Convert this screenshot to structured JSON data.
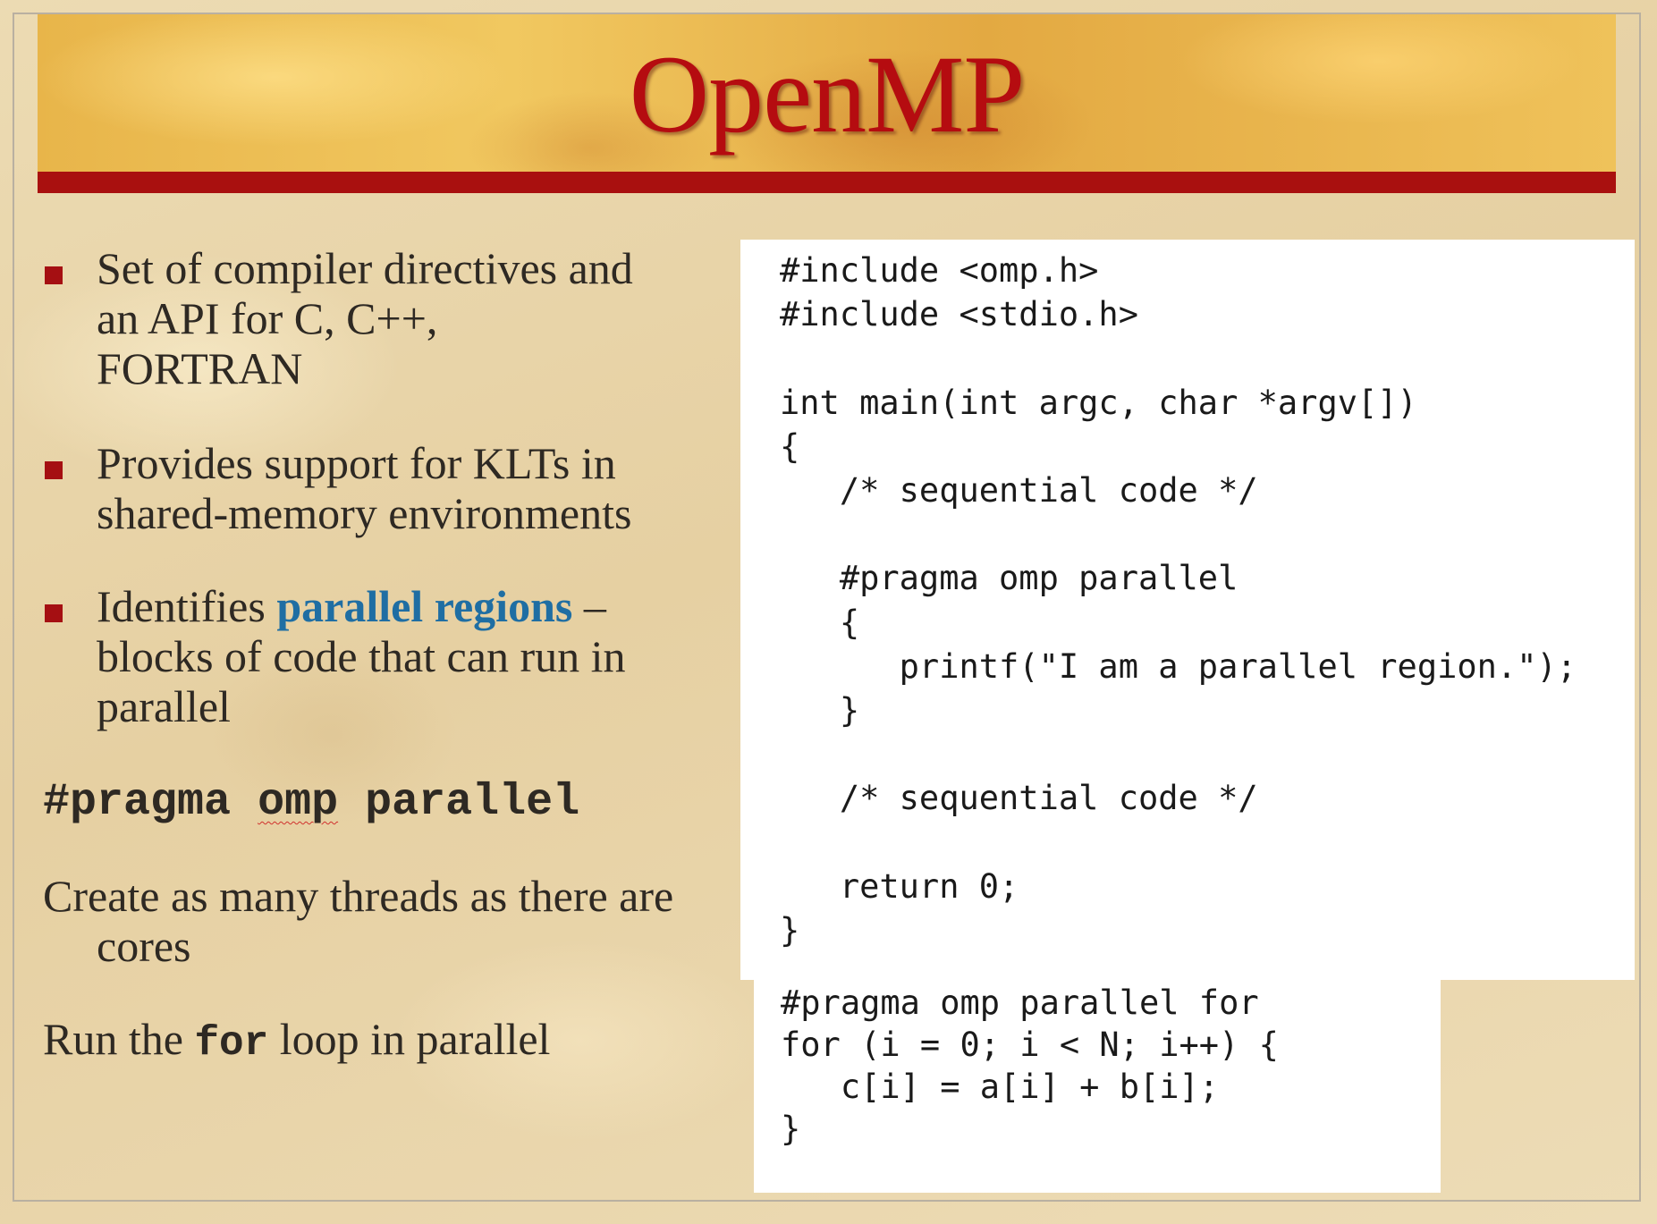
{
  "slide": {
    "title": "OpenMP",
    "bullets": [
      {
        "line1": "Set of compiler directives and",
        "line2": "an API for C, C++,",
        "line3": "FORTRAN"
      },
      {
        "line1": "Provides support for KLTs in",
        "line2": "shared-memory environments"
      },
      {
        "text_before": "Identifies ",
        "highlight": "parallel regions",
        "text_after": " –",
        "line2": "blocks of code that can run in",
        "line3": "parallel"
      }
    ],
    "directive": {
      "word1": "#pragma",
      "word2": "omp",
      "word3": "parallel"
    },
    "notes": {
      "threads": "Create as many threads as there are cores",
      "loop_before": "Run the ",
      "loop_code": "for",
      "loop_after": " loop in parallel"
    },
    "code_main": [
      "#include <omp.h>",
      "#include <stdio.h>",
      "",
      "int main(int argc, char *argv[])",
      "{",
      "   /* sequential code */",
      "",
      "   #pragma omp parallel",
      "   {",
      "      printf(\"I am a parallel region.\");",
      "   }",
      "",
      "   /* sequential code */",
      "",
      "   return 0;",
      "}"
    ],
    "code_loop": [
      "#pragma omp parallel for",
      "for (i = 0; i < N; i++) {",
      "   c[i] = a[i] + b[i];",
      "}"
    ],
    "colors": {
      "title": "#b50c10",
      "title_rule": "#a9100f",
      "bullet_marker": "#a50f12",
      "highlight": "#1f6ea3",
      "body_text": "#2e2923"
    }
  }
}
